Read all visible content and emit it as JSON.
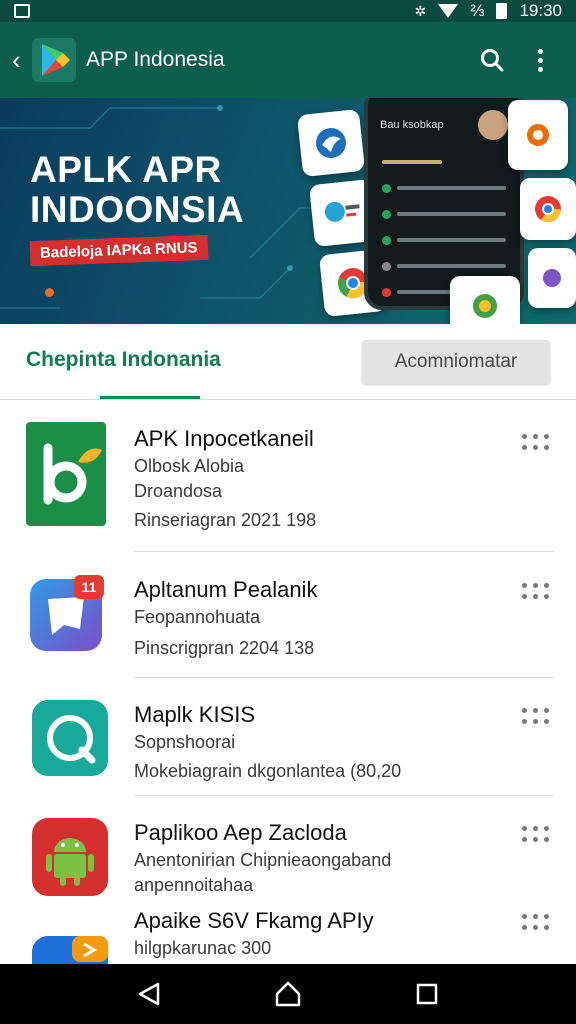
{
  "status_bar": {
    "time": "19:30",
    "battery_label": "⅔"
  },
  "app_bar": {
    "title": "APP Indonesia"
  },
  "banner": {
    "title_line1": "APLK APR",
    "title_line2": "INDOONSIA",
    "ribbon": "Badeloja IAPKa RNUS",
    "phone_header": "Bau ksobkap"
  },
  "tabs": {
    "active": "Chepinta Indonania",
    "button": "Acomniomatar"
  },
  "apps": [
    {
      "title": "APK Inpocetkaneil",
      "lines": [
        "Olbosk Alobia",
        "Droandosa",
        "Rinseriagran 2021 198"
      ],
      "icon": "leaf-b-icon",
      "color": "#1b8f47"
    },
    {
      "title": "Apltanum Pealanik",
      "lines": [
        "Feopannohuata",
        "Pinscrigpran 2204 138"
      ],
      "icon": "message-icon",
      "color": "#4f5fd0"
    },
    {
      "title": "Maplk KISIS",
      "lines": [
        "Sopnshoorai",
        "Mokebiagrain dkgonlantea (80,20"
      ],
      "icon": "phone-icon",
      "color": "#19a99a"
    },
    {
      "title": "Paplikoo Aep Zacloda",
      "lines": [
        "Anentonirian Chipnieaongaband",
        "anpennoitahaa"
      ],
      "icon": "android-icon",
      "color": "#d32f2f"
    },
    {
      "title": "Apaike S6V Fkamg APIy",
      "lines": [
        "hilgpkarunac 300"
      ],
      "icon": "blue-app-icon",
      "color": "#1e6fd9"
    }
  ],
  "colors": {
    "app_bar": "#0c5e4e",
    "accent": "#107e4c",
    "banner_start": "#0b3b5e",
    "banner_end": "#0d6a6a"
  }
}
